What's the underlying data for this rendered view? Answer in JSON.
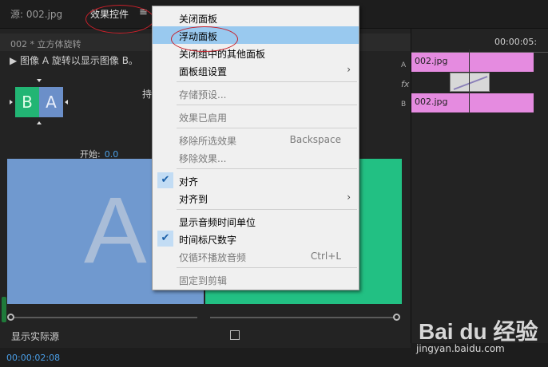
{
  "tabs": {
    "source": "源: 002.jpg",
    "effects": "效果控件",
    "menu_glyph": "≡"
  },
  "clip_header": {
    "title": "002 * 立方体旋转",
    "description": "▶  图像 A 旋转以显示图像 B。",
    "partial_label": "持"
  },
  "preview": {
    "thumb_a": "B",
    "thumb_b": "A",
    "big_letter": "A"
  },
  "start": {
    "label": "开始:",
    "value": "0.0"
  },
  "show_actual_source": "显示实际源",
  "timecode": "00:00:02:08",
  "timeline": {
    "time": "00:00:05:",
    "track_a": "A",
    "track_b": "B",
    "fx": "fx",
    "clip_a": "002.jpg",
    "clip_b": "002.jpg"
  },
  "menu": {
    "items": [
      {
        "label": "关闭面板",
        "enabled": true
      },
      {
        "label": "浮动面板",
        "enabled": true,
        "highlighted": true
      },
      {
        "label": "关闭组中的其他面板",
        "enabled": true
      },
      {
        "label": "面板组设置",
        "enabled": true,
        "submenu": true
      },
      {
        "label": "存储预设...",
        "enabled": false
      },
      {
        "label": "效果已启用",
        "enabled": false
      },
      {
        "label": "移除所选效果",
        "enabled": false,
        "shortcut": "Backspace"
      },
      {
        "label": "移除效果...",
        "enabled": false
      },
      {
        "label": "对齐",
        "enabled": true,
        "checked": true
      },
      {
        "label": "对齐到",
        "enabled": true,
        "submenu": true
      },
      {
        "label": "显示音频时间单位",
        "enabled": true
      },
      {
        "label": "时间标尺数字",
        "enabled": true,
        "checked": true
      },
      {
        "label": "仅循环播放音频",
        "enabled": false,
        "shortcut": "Ctrl+L"
      },
      {
        "label": "固定到剪辑",
        "enabled": false
      }
    ],
    "check_glyph": "✔",
    "submenu_glyph": "›"
  },
  "watermark": {
    "logo": "Bai du 经验",
    "url": "jingyan.baidu.com"
  },
  "colors": {
    "highlight": "#99c9ef",
    "accent_blue": "#4a9fe8",
    "clip_pink": "#e58be0",
    "annotation_red": "#c8202a"
  }
}
